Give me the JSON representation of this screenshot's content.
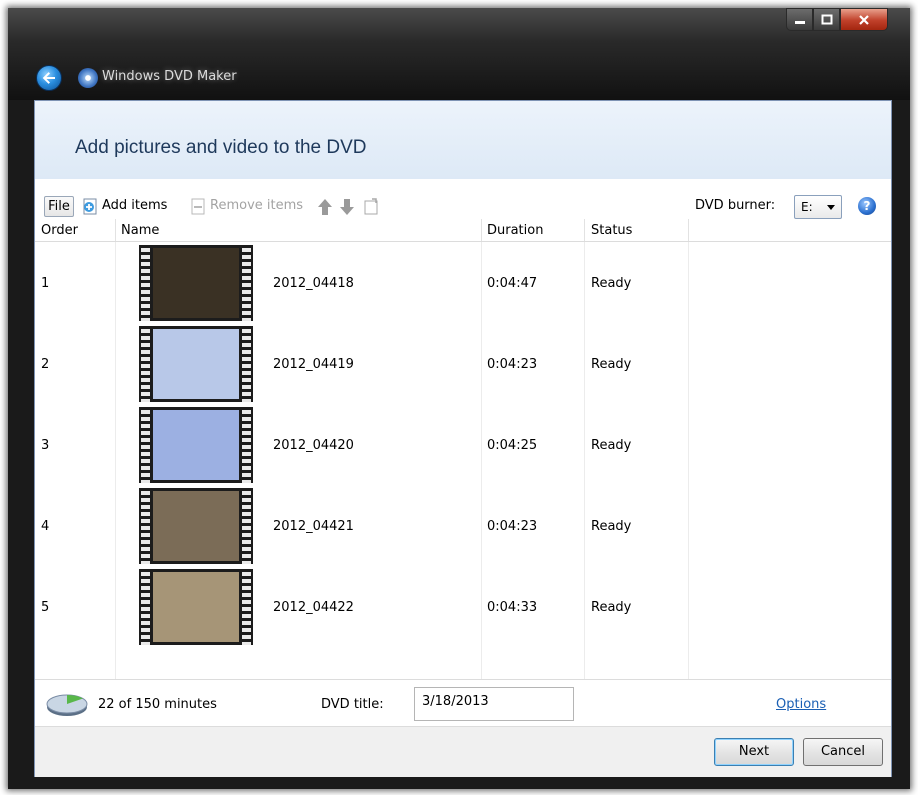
{
  "window": {
    "app_title": "Windows DVD Maker",
    "page_title": "Add pictures and video to the DVD",
    "icons": [
      "back-arrow-icon",
      "dvd-maker-icon",
      "minimize-icon",
      "maximize-icon",
      "close-icon"
    ]
  },
  "toolbar": {
    "file_label": "File",
    "add_items_label": "Add items",
    "remove_items_label": "Remove items",
    "burner_label": "DVD burner:",
    "burner_value": "E:",
    "icons": [
      "add-items-icon",
      "remove-items-icon",
      "move-up-icon",
      "move-down-icon",
      "edit-icon",
      "help-icon"
    ]
  },
  "columns": {
    "order": "Order",
    "name": "Name",
    "duration": "Duration",
    "status": "Status"
  },
  "items": [
    {
      "order": "1",
      "name": "2012_04418",
      "duration": "0:04:47",
      "status": "Ready",
      "thumb_color": "#3a3124"
    },
    {
      "order": "2",
      "name": "2012_04419",
      "duration": "0:04:23",
      "status": "Ready",
      "thumb_color": "#b8c8e8"
    },
    {
      "order": "3",
      "name": "2012_04420",
      "duration": "0:04:25",
      "status": "Ready",
      "thumb_color": "#9cb0e2"
    },
    {
      "order": "4",
      "name": "2012_04421",
      "duration": "0:04:23",
      "status": "Ready",
      "thumb_color": "#7b6c57"
    },
    {
      "order": "5",
      "name": "2012_04422",
      "duration": "0:04:33",
      "status": "Ready",
      "thumb_color": "#a69577"
    }
  ],
  "footer": {
    "minutes_used": 22,
    "minutes_total": 150,
    "minutes_text": "22 of 150 minutes",
    "dvd_title_label": "DVD title:",
    "dvd_title_value": "3/18/2013",
    "options_label": "Options",
    "next_label": "Next",
    "cancel_label": "Cancel"
  }
}
